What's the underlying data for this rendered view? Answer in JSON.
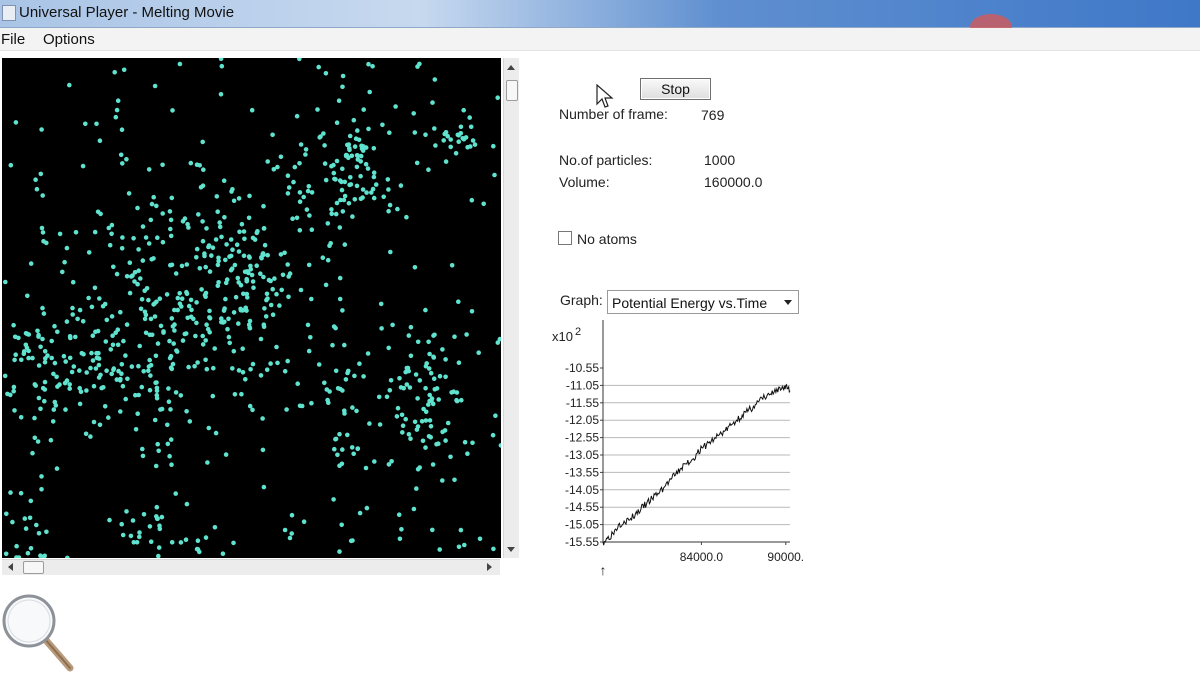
{
  "window": {
    "title": "Universal Player - Melting Movie"
  },
  "menu": {
    "items": [
      "File",
      "Options"
    ]
  },
  "controls": {
    "stop_label": "Stop",
    "frame_label": "Number of frame:",
    "frame_value": "769",
    "particles_label": "No.of particles:",
    "particles_value": "1000",
    "volume_label": "Volume:",
    "volume_value": "160000.0",
    "no_atoms_label": "No atoms",
    "no_atoms_checked": false,
    "graph_label": "Graph:",
    "graph_selected": "Potential Energy vs.Time"
  },
  "colors": {
    "particle": "#5fe3cf",
    "canvas_bg": "#000000"
  },
  "icons": [
    "app-icon",
    "mouse-pointer-icon",
    "magnifier-icon"
  ],
  "chart_data": {
    "type": "line",
    "title": "",
    "xlabel": "",
    "ylabel": "",
    "y_multiplier_label": "x10",
    "y_multiplier_exp": "2",
    "ylim": [
      -15.55,
      -10.55
    ],
    "xlim": [
      77000,
      90300
    ],
    "y_ticks": [
      "-10.55",
      "-11.05",
      "-11.55",
      "-12.05",
      "-12.55",
      "-13.05",
      "-13.55",
      "-14.05",
      "-14.55",
      "-15.05",
      "-15.55"
    ],
    "x_ticks": [
      {
        "value": 84000,
        "label": "84000.0"
      },
      {
        "value": 90000,
        "label": "90000."
      }
    ],
    "marker_label": "↑",
    "grid": true,
    "series": [
      {
        "x": [
          77000,
          77300,
          77700,
          78100,
          78500,
          78900,
          79300,
          79700,
          80100,
          80500,
          80900,
          81300,
          81700,
          82100,
          82500,
          82900,
          83300,
          83700,
          84100,
          84500,
          84900,
          85300,
          85700,
          86100,
          86500,
          86900,
          87300,
          87700,
          88100,
          88500,
          88900,
          89300,
          89700,
          90000,
          90300
        ],
        "y": [
          -15.55,
          -15.45,
          -15.3,
          -15.05,
          -14.95,
          -14.92,
          -14.75,
          -14.6,
          -14.45,
          -14.3,
          -14.15,
          -14.0,
          -13.8,
          -13.65,
          -13.45,
          -13.3,
          -13.2,
          -13.0,
          -12.85,
          -12.7,
          -12.6,
          -12.45,
          -12.35,
          -12.2,
          -12.05,
          -11.9,
          -11.8,
          -11.65,
          -11.5,
          -11.4,
          -11.3,
          -11.25,
          -11.15,
          -11.05,
          -11.2
        ]
      }
    ]
  }
}
